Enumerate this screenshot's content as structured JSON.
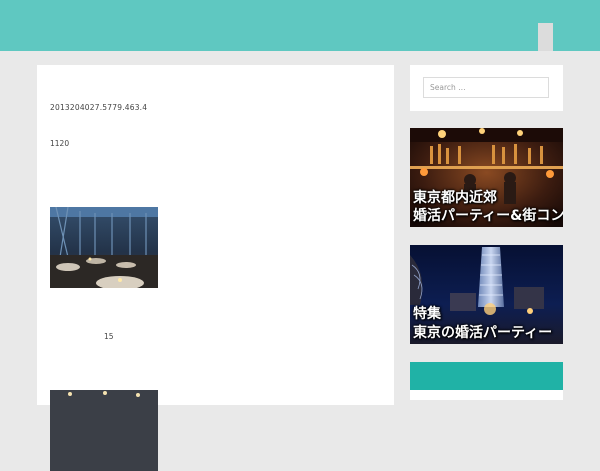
{
  "header": {
    "background_color": "#5fc8c1",
    "menu_toggle_icon": "menu-toggle-icon"
  },
  "post": {
    "meta_text": "2013204027.5779.463.4",
    "count_text": "1120",
    "number_text": "15",
    "photo_1": "venue-interior-photo",
    "photo_2": "venue-photo"
  },
  "sidebar": {
    "search": {
      "placeholder": "Search …"
    },
    "banners": [
      {
        "line_1": "東京都内近郊",
        "line_2": "婚活パーティー&街コン",
        "image": "night-bar-photo"
      },
      {
        "line_1": "特集",
        "line_2": "東京の婚活パーティー",
        "image": "night-tower-photo"
      }
    ],
    "widget_color": "#20b2a6"
  }
}
